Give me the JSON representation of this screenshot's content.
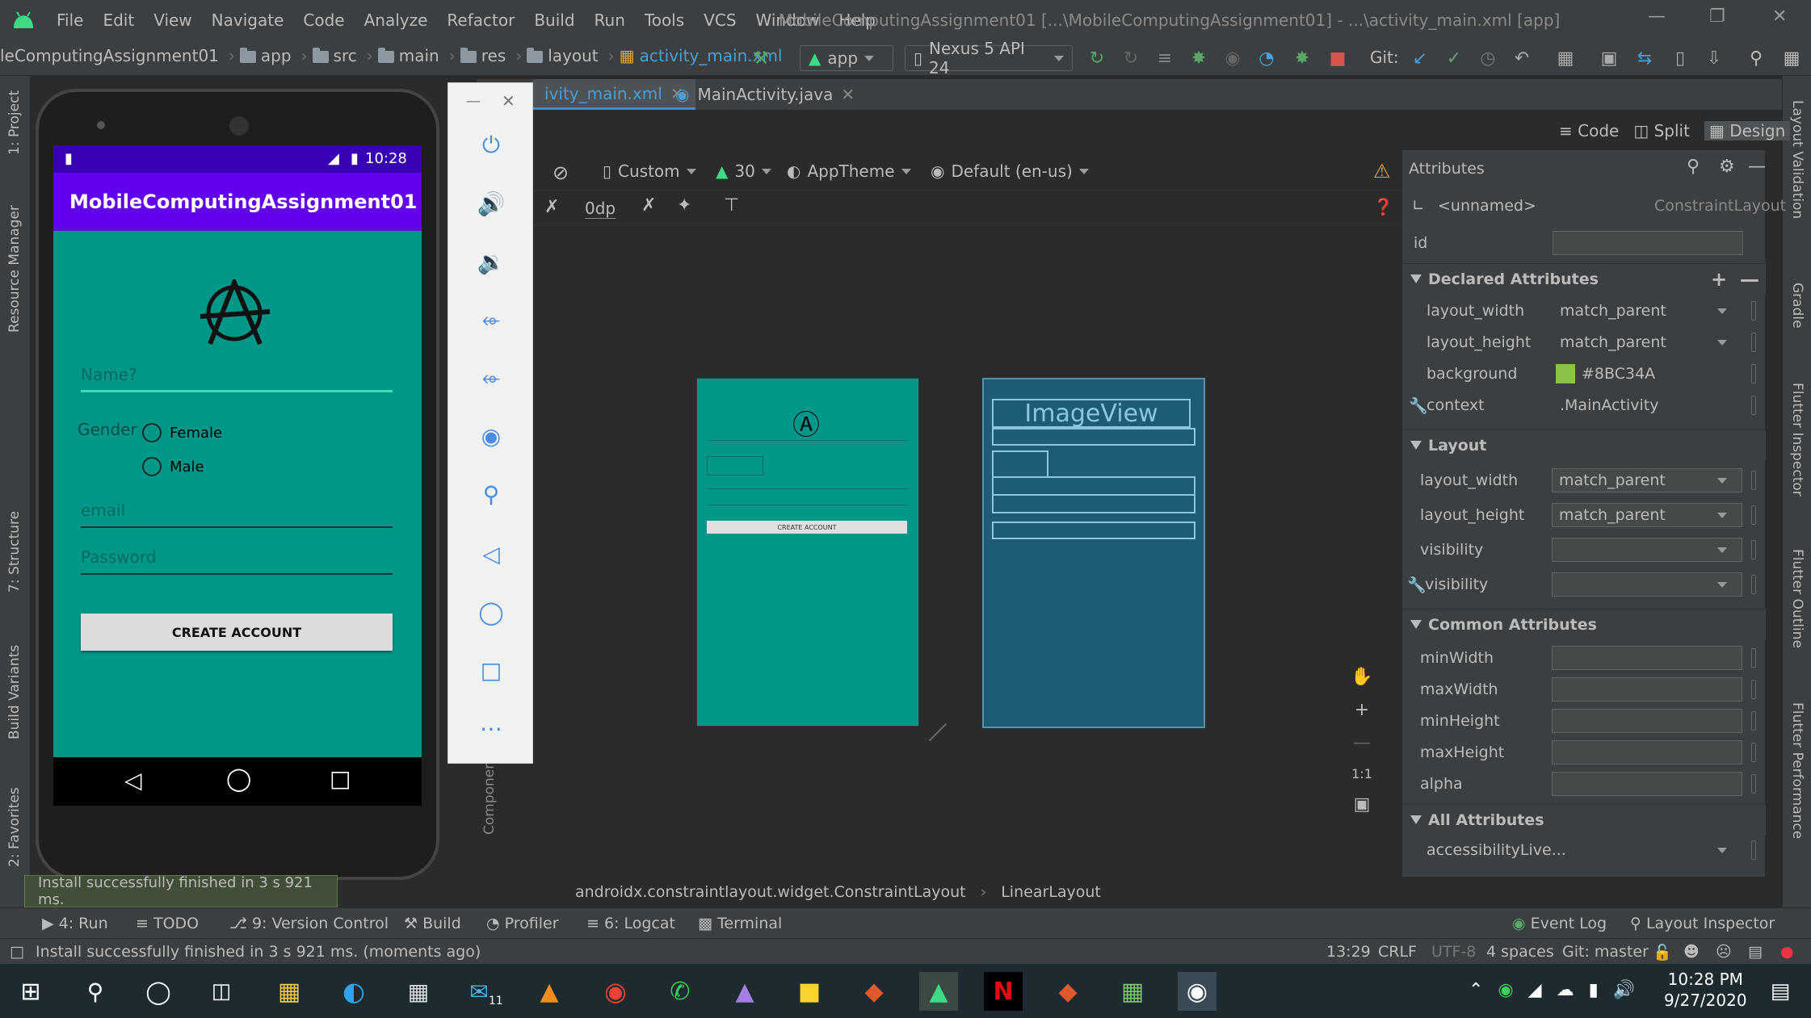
{
  "window": {
    "menu": [
      "File",
      "Edit",
      "View",
      "Navigate",
      "Code",
      "Analyze",
      "Refactor",
      "Build",
      "Run",
      "Tools",
      "VCS",
      "Window",
      "Help"
    ],
    "title": "MobileComputingAssignment01 [...\\MobileComputingAssignment01] - ...\\activity_main.xml [app]"
  },
  "breadcrumbs": [
    "leComputingAssignment01",
    "app",
    "src",
    "main",
    "res",
    "layout",
    "activity_main.xml"
  ],
  "toolbar": {
    "run_config": "app",
    "device": "Nexus 5 API 24",
    "git_label": "Git:"
  },
  "editor_tabs": [
    {
      "label": "ivity_main.xml",
      "active": true
    },
    {
      "label": "MainActivity.java",
      "active": false
    }
  ],
  "view_modes": {
    "code": "Code",
    "split": "Split",
    "design": "Design"
  },
  "design_toolbar": {
    "device_size": "Custom",
    "api": "30",
    "theme": "AppTheme",
    "locale": "Default (en-us)",
    "margin": "0dp"
  },
  "preview": {
    "blueprint_label": "ImageView",
    "button_label": "CREATE ACCOUNT"
  },
  "component_tree_label": "Componen",
  "breadcrumb_bottom": [
    "androidx.constraintlayout.widget.ConstraintLayout",
    "LinearLayout"
  ],
  "attributes": {
    "header": "Attributes",
    "component_name": "<unnamed>",
    "component_type": "ConstraintLayout",
    "id_label": "id",
    "id_value": "",
    "declared_title": "Declared Attributes",
    "declared": [
      {
        "key": "layout_width",
        "value": "match_parent"
      },
      {
        "key": "layout_height",
        "value": "match_parent"
      },
      {
        "key": "background",
        "value": "#8BC34A"
      },
      {
        "key": "context",
        "value": ".MainActivity"
      }
    ],
    "layout_title": "Layout",
    "layout": [
      {
        "key": "layout_width",
        "value": "match_parent"
      },
      {
        "key": "layout_height",
        "value": "match_parent"
      },
      {
        "key": "visibility",
        "value": ""
      },
      {
        "key": "visibility",
        "value": ""
      }
    ],
    "common_title": "Common Attributes",
    "common": [
      "minWidth",
      "maxWidth",
      "minHeight",
      "maxHeight",
      "alpha"
    ],
    "all_title": "All Attributes",
    "all_first": "accessibilityLive...",
    "bg_color": "#8BC34A"
  },
  "app": {
    "time": "10:28",
    "title": "MobileComputingAssignment01",
    "name_placeholder": "Name?",
    "gender_label": "Gender",
    "gender_options": [
      "Female",
      "Male"
    ],
    "email_placeholder": "email",
    "password_placeholder": "Password",
    "button": "CREATE ACCOUNT",
    "bg": "#009688",
    "bar": "#6200EE"
  },
  "toast": "Install successfully finished in 3 s 921 ms.",
  "left_strip": [
    "1: Project",
    "Resource Manager",
    "7: Structure",
    "Build Variants",
    "2: Favorites"
  ],
  "right_strip": [
    "Layout Validation",
    "Gradle",
    "Flutter Inspector",
    "Flutter Outline",
    "Flutter Performance"
  ],
  "bottom_tools": [
    "4: Run",
    "TODO",
    "9: Version Control",
    "Build",
    "Profiler",
    "6: Logcat",
    "Terminal"
  ],
  "bottom_right_tools": [
    "Event Log",
    "Layout Inspector"
  ],
  "status": {
    "message": "Install successfully finished in 3 s 921 ms. (moments ago)",
    "position": "13:29",
    "line_sep": "CRLF",
    "encoding": "UTF-8",
    "indent": "4 spaces",
    "branch": "Git: master"
  },
  "taskbar": {
    "time": "10:28 PM",
    "date": "9/27/2020",
    "mail_badge": "11"
  }
}
